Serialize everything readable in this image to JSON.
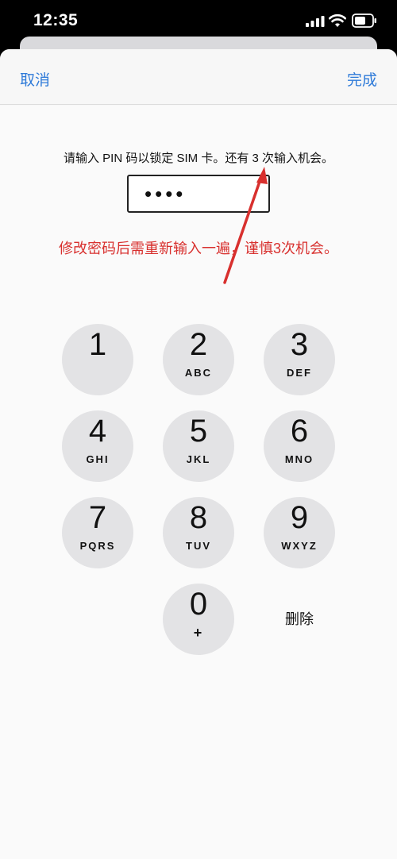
{
  "status_bar": {
    "time": "12:35"
  },
  "nav": {
    "cancel_label": "取消",
    "done_label": "完成"
  },
  "prompt": "请输入 PIN 码以锁定 SIM 卡。还有 3 次输入机会。",
  "pin_field": {
    "value": "••••"
  },
  "annotation": {
    "text": "修改密码后需重新输入一遍，谨慎3次机会。",
    "color": "#d8302e"
  },
  "keypad": {
    "keys": [
      {
        "digit": "1",
        "letters": ""
      },
      {
        "digit": "2",
        "letters": "ABC"
      },
      {
        "digit": "3",
        "letters": "DEF"
      },
      {
        "digit": "4",
        "letters": "GHI"
      },
      {
        "digit": "5",
        "letters": "JKL"
      },
      {
        "digit": "6",
        "letters": "MNO"
      },
      {
        "digit": "7",
        "letters": "PQRS"
      },
      {
        "digit": "8",
        "letters": "TUV"
      },
      {
        "digit": "9",
        "letters": "WXYZ"
      },
      {
        "digit": "0",
        "letters": "+"
      }
    ],
    "delete_label": "删除"
  },
  "colors": {
    "accent": "#2f7bd9",
    "key_bg": "#e3e3e5",
    "annotation": "#d8302e"
  }
}
